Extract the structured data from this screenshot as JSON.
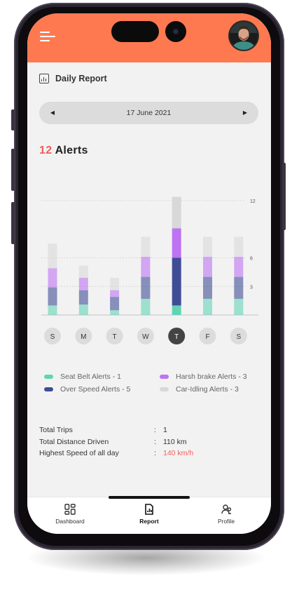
{
  "colors": {
    "accent": "#ff7950",
    "highlight": "#f05d5d",
    "seat_belt": "#62d4b4",
    "over_speed": "#3f4d96",
    "harsh_brake": "#bd73f2",
    "idling": "#d8d8d8",
    "selected_day": "#444444"
  },
  "header": {
    "menu_icon": "hamburger-menu-icon",
    "avatar": "user-avatar"
  },
  "report": {
    "title": "Daily Report",
    "icon": "bar-chart-icon"
  },
  "date_selector": {
    "prev_icon": "triangle-left-icon",
    "date": "17 June 2021",
    "next_icon": "triangle-right-icon"
  },
  "alerts": {
    "count": "12",
    "label": "Alerts"
  },
  "chart_data": {
    "type": "bar",
    "stacked": true,
    "categories": [
      "S",
      "M",
      "T",
      "W",
      "T",
      "F",
      "S"
    ],
    "selected_index": 4,
    "series": [
      {
        "key": "seat_belt",
        "values": [
          1.0,
          1.1,
          0.5,
          1.7,
          1.0,
          1.7,
          1.7
        ]
      },
      {
        "key": "over_speed",
        "values": [
          1.9,
          1.5,
          1.4,
          2.3,
          5.0,
          2.3,
          2.3
        ]
      },
      {
        "key": "harsh_brake",
        "values": [
          2.0,
          1.3,
          0.7,
          2.1,
          3.1,
          2.1,
          2.1
        ]
      },
      {
        "key": "idling",
        "values": [
          2.6,
          1.3,
          1.3,
          2.1,
          3.3,
          2.1,
          2.1
        ]
      }
    ],
    "ylim": [
      0,
      12
    ],
    "y_ticks": [
      3,
      6,
      12
    ],
    "y_tick_labels": [
      "3",
      "6",
      "12"
    ],
    "grid": true,
    "selected_emphasis": "full opacity for the selected day, faded for others"
  },
  "legend": [
    {
      "label": "Seat Belt Alerts - 1",
      "color": "#62d4b4"
    },
    {
      "label": "Harsh brake Alerts - 3",
      "color": "#bd73f2"
    },
    {
      "label": "Over Speed Alerts - 5",
      "color": "#3f4d96"
    },
    {
      "label": "Car-Idling Alerts - 3",
      "color": "#d8d8d8"
    }
  ],
  "stats": [
    {
      "label": "Total Trips",
      "value": "1",
      "highlight": false
    },
    {
      "label": "Total Distance Driven",
      "value": "110 km",
      "highlight": false
    },
    {
      "label": "Highest Speed of all day",
      "value": "140 km/h",
      "highlight": true
    }
  ],
  "bottom_nav": [
    {
      "label": "Dashboard",
      "icon": "dashboard-grid-icon",
      "active": false
    },
    {
      "label": "Report",
      "icon": "report-icon",
      "active": true
    },
    {
      "label": "Profile",
      "icon": "profile-users-icon",
      "active": false
    }
  ]
}
